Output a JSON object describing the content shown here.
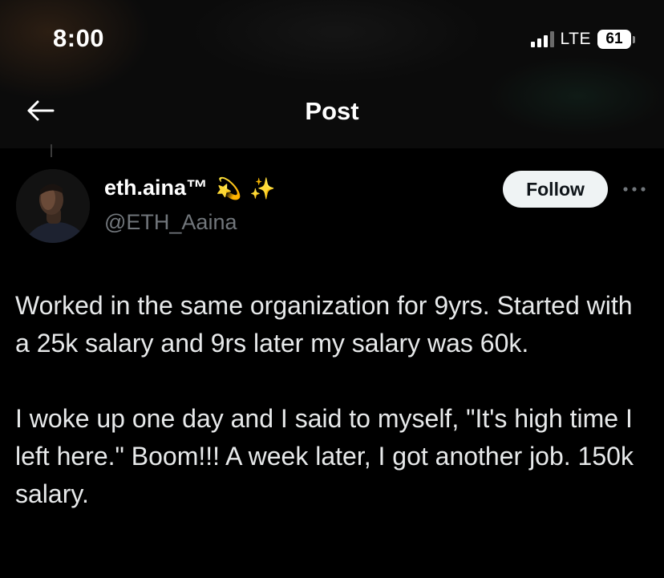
{
  "status_bar": {
    "time": "8:00",
    "network": "LTE",
    "battery": "61"
  },
  "header": {
    "title": "Post",
    "back_icon": "arrow-left-icon"
  },
  "post": {
    "author": {
      "name": "eth.aina™",
      "emojis": [
        "💫",
        "✨"
      ],
      "handle": "@ETH_Aaina"
    },
    "follow_label": "Follow",
    "more_icon": "more-horizontal-icon",
    "paragraphs": [
      "Worked in the same organization for 9yrs. Started with a 25k salary and 9rs later my salary was 60k.",
      "I woke up one day and I said to myself, \"It's high time I left here.\" Boom!!! A week later, I got another job. 150k salary."
    ]
  },
  "colors": {
    "background": "#000000",
    "text": "#e7e9ea",
    "secondary_text": "#71767b",
    "follow_button_bg": "#eff3f4"
  }
}
